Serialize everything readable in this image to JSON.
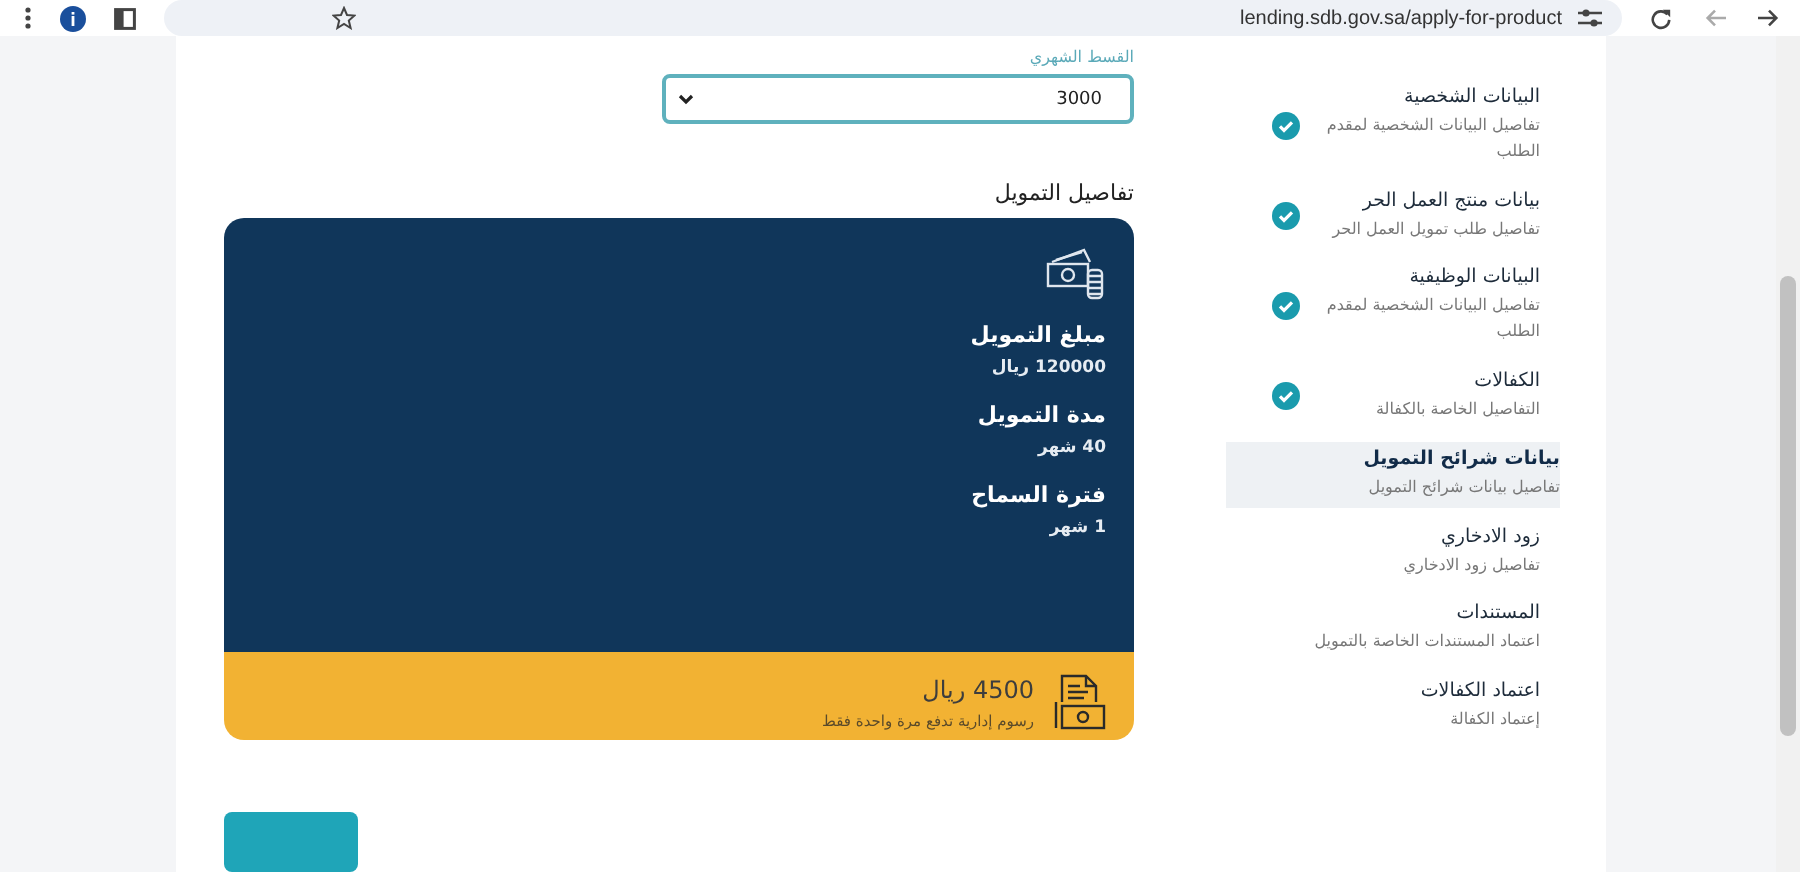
{
  "browser": {
    "url": "lending.sdb.gov.sa/apply-for-product"
  },
  "installment": {
    "label": "القسط الشهري",
    "value": "3000"
  },
  "details": {
    "heading": "تفاصيل التمويل",
    "items": [
      {
        "label": "مبلغ التمويل",
        "value": "120000 ريال"
      },
      {
        "label": "مدة التمويل",
        "value": "40 شهر"
      },
      {
        "label": "فترة السماح",
        "value": "1 شهر"
      }
    ],
    "fee": {
      "amount": "4500 ريال",
      "note": "رسوم إدارية تدفع مرة واحدة فقط"
    }
  },
  "steps": [
    {
      "title": "البيانات الشخصية",
      "subtitle": "تفاصيل البيانات الشخصية لمقدم الطلب",
      "done": true,
      "selected": false
    },
    {
      "title": "بيانات منتج العمل الحر",
      "subtitle": "تفاصيل طلب تمويل العمل الحر",
      "done": true,
      "selected": false
    },
    {
      "title": "البيانات الوظيفية",
      "subtitle": "تفاصيل البيانات الشخصية لمقدم الطلب",
      "done": true,
      "selected": false
    },
    {
      "title": "الكفالات",
      "subtitle": "التفاصيل الخاصة بالكفالة",
      "done": true,
      "selected": false
    },
    {
      "title": "بيانات شرائح التمويل",
      "subtitle": "تفاصيل بيانات شرائح التمويل",
      "done": false,
      "selected": true
    },
    {
      "title": "زود الادخاري",
      "subtitle": "تفاصيل زود الادخاري",
      "done": false,
      "selected": false
    },
    {
      "title": "المستندات",
      "subtitle": "اعتماد المستندات الخاصة بالتمويل",
      "done": false,
      "selected": false
    },
    {
      "title": "اعتماد الكفالات",
      "subtitle": "إعتماد الكفالة",
      "done": false,
      "selected": false
    }
  ]
}
